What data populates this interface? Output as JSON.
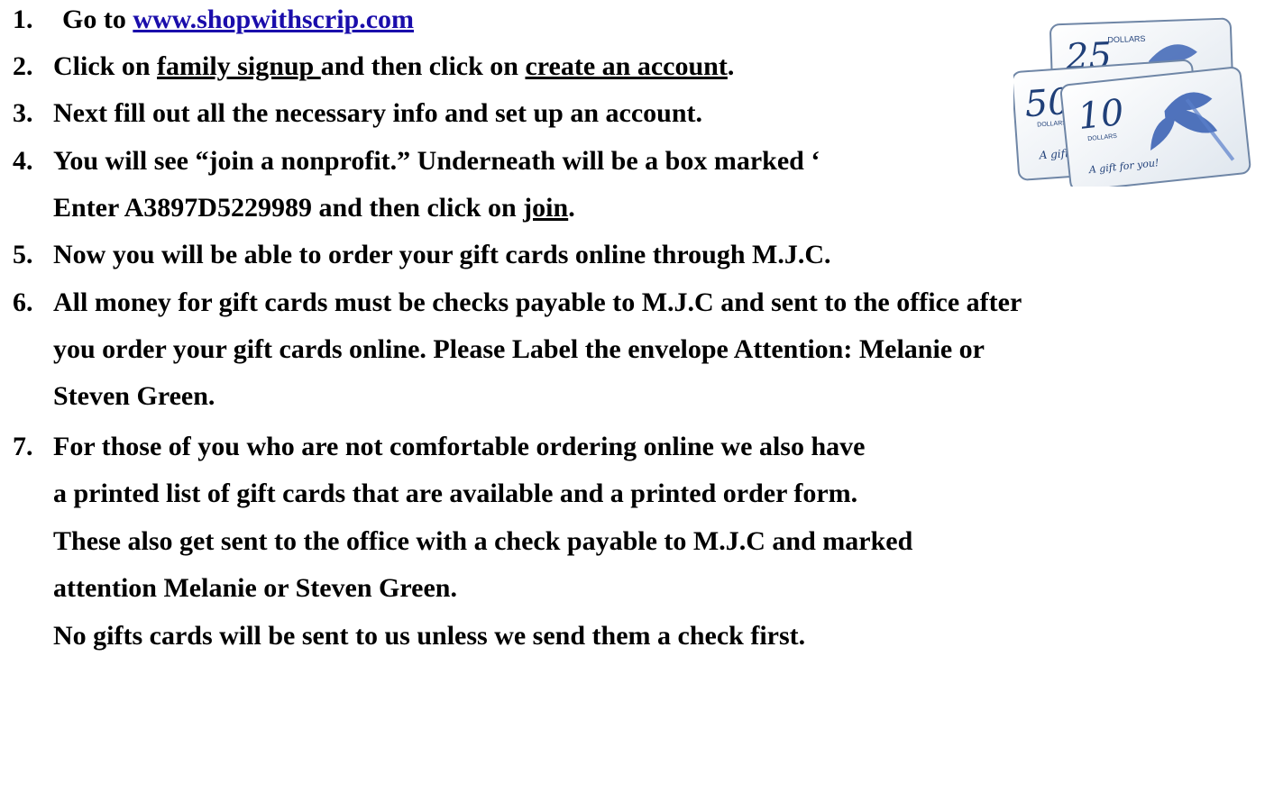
{
  "steps": {
    "s1": {
      "num": "1.",
      "pre": "Go to ",
      "link": "www.shopwithscrip.com"
    },
    "s2": {
      "num": "2.",
      "pre": "Click on ",
      "family_signup": "family signup ",
      "mid": "and then click on ",
      "create_account": "create an account",
      "end": "."
    },
    "s3": {
      "num": "3.",
      "text": "Next fill out all the necessary info and set up an account."
    },
    "s4": {
      "num": "4.",
      "line1": "You will see “join a nonprofit.” Underneath will be a box marked ‘",
      "close": "”",
      "pre2": "Enter A3897D5229989 and then click on ",
      "join": "join",
      "end": "."
    },
    "s5": {
      "num": "5.",
      "text": "Now you will be able to order your gift cards online through M.J.C."
    },
    "s6": {
      "num": "6.",
      "line1": "All money for gift cards must be checks payable to M.J.C and sent to the office after",
      "line2": "you order your gift cards online. Please Label the envelope Attention: Melanie or",
      "line3": "Steven Green."
    },
    "s7": {
      "num": "7.",
      "line1": "For those of you who are not comfortable ordering online we also have",
      "line2": "a printed list of gift cards that are available and a printed order form.",
      "line3": "These also get sent to the office with a check payable to M.J.C and marked",
      "line4": "attention Melanie or Steven Green.",
      "line5": "No gifts cards will be sent to us unless we send them a check first."
    }
  },
  "gift_cards": {
    "card1": {
      "amount": "25",
      "unit": "DOLLARS"
    },
    "card2": {
      "amount": "50",
      "unit": "DOLLARS",
      "tag": "A gift"
    },
    "card3": {
      "amount": "10",
      "unit": "DOLLARS",
      "tag": "A gift for you!"
    }
  }
}
